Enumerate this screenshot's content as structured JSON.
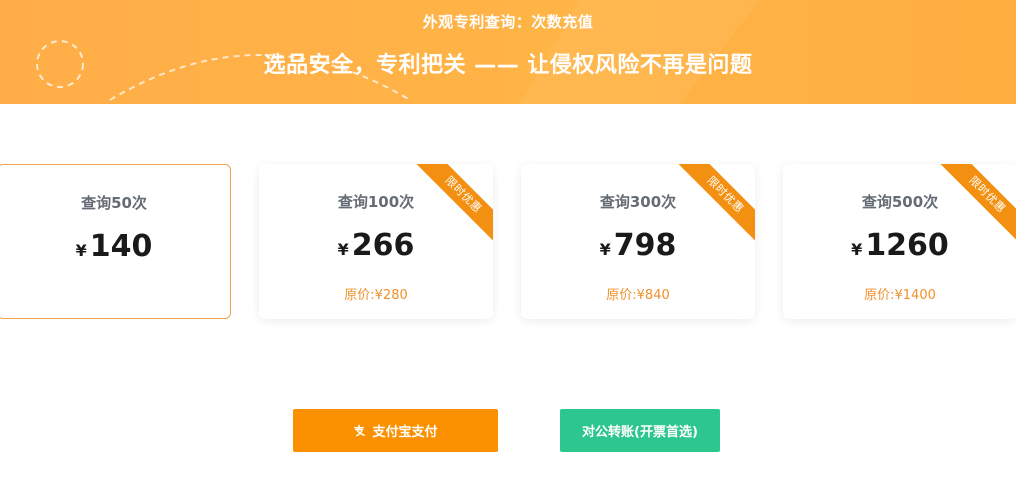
{
  "banner": {
    "subtitle": "外观专利查询：次数充值",
    "title": "选品安全，专利把关 —— 让侵权风险不再是问题",
    "background_color": "#ffb146"
  },
  "plans": [
    {
      "name": "查询50次",
      "currency": "¥",
      "price": "140",
      "original_price": "",
      "ribbon": "",
      "selected": true
    },
    {
      "name": "查询100次",
      "currency": "¥",
      "price": "266",
      "original_price": "原价:¥280",
      "ribbon": "限时优惠",
      "selected": false
    },
    {
      "name": "查询300次",
      "currency": "¥",
      "price": "798",
      "original_price": "原价:¥840",
      "ribbon": "限时优惠",
      "selected": false
    },
    {
      "name": "查询500次",
      "currency": "¥",
      "price": "1260",
      "original_price": "原价:¥1400",
      "ribbon": "限时优惠",
      "selected": false
    }
  ],
  "payment": {
    "alipay_label": "支付宝支付",
    "alipay_icon": "alipay-icon",
    "transfer_label": "对公转账(开票首选)"
  },
  "colors": {
    "accent_orange": "#fb9100",
    "ribbon_orange": "#f39012",
    "original_price": "#f0912b",
    "transfer_green": "#2ec68f",
    "selected_border": "#f0a44a"
  }
}
